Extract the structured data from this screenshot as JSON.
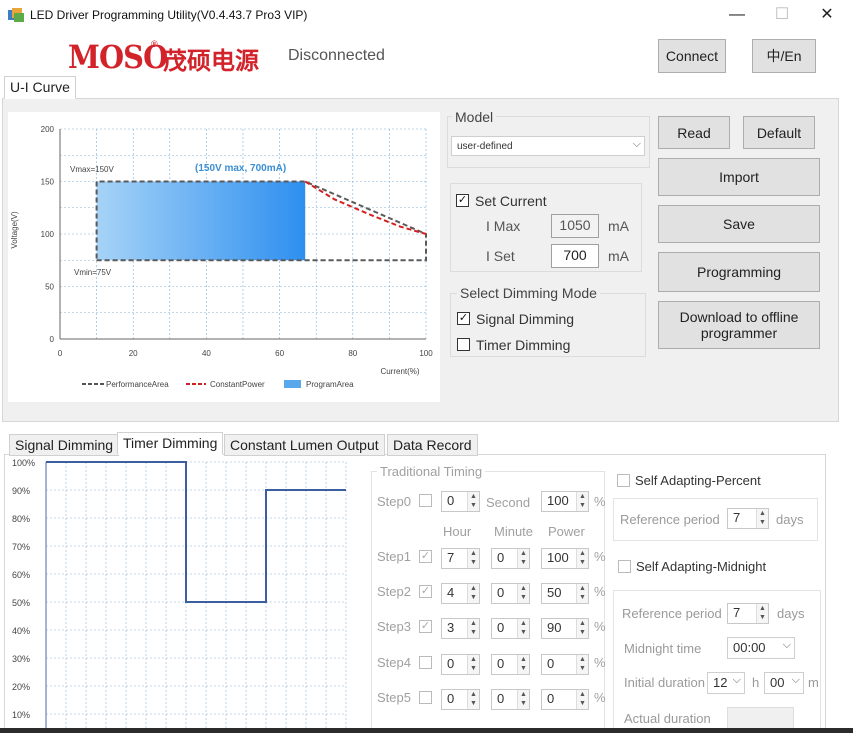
{
  "window": {
    "title": "LED Driver Programming Utility(V0.4.43.7 Pro3 VIP)",
    "minimize": "—",
    "maximize": "☐",
    "close": "✕"
  },
  "header": {
    "logo_en": "MOSO",
    "logo_reg": "®",
    "logo_cn": "茂硕电源",
    "status": "Disconnected",
    "connect_label": "Connect",
    "lang_label": "中/En"
  },
  "top_tab": "U-I Curve",
  "model": {
    "title": "Model",
    "selected": "user-defined"
  },
  "set_current": {
    "checkbox_label": "Set Current",
    "checked": true,
    "imax_label": "I Max",
    "imax_value": "1050",
    "iset_label": "I Set",
    "iset_value": "700",
    "unit": "mA"
  },
  "dimming_mode": {
    "title": "Select Dimming Mode",
    "signal_label": "Signal Dimming",
    "signal_checked": true,
    "timer_label": "Timer Dimming",
    "timer_checked": false
  },
  "buttons": {
    "read": "Read",
    "default": "Default",
    "import": "Import",
    "save": "Save",
    "programming": "Programming",
    "download_line1": "Download to offline",
    "download_line2": "programmer"
  },
  "ui_chart": {
    "ylabel": "Voltage(V)",
    "xlabel": "Current(%)",
    "yticks": [
      "0",
      "50",
      "100",
      "150",
      "200"
    ],
    "xticks": [
      "0",
      "20",
      "40",
      "60",
      "80",
      "100"
    ],
    "vmax_label": "Vmax=150V",
    "vmin_label": "Vmin=75V",
    "annotation": "(150V max, 700mA)",
    "legend": [
      "PerformanceArea",
      "ConstantPower",
      "ProgramArea"
    ]
  },
  "chart_data": [
    {
      "type": "line",
      "xlabel": "Current(%)",
      "ylabel": "Voltage(V)",
      "xlim": [
        0,
        100
      ],
      "ylim": [
        0,
        200
      ],
      "grid": true,
      "legend_position": "bottom",
      "series": [
        {
          "name": "PerformanceArea",
          "points": [
            [
              10,
              75
            ],
            [
              100,
              75
            ],
            [
              100,
              100
            ],
            [
              67,
              150
            ],
            [
              10,
              150
            ],
            [
              10,
              75
            ]
          ]
        },
        {
          "name": "ConstantPower",
          "points": [
            [
              67,
              150
            ],
            [
              75,
              133
            ],
            [
              85,
              118
            ],
            [
              93,
              107
            ],
            [
              100,
              100
            ]
          ]
        },
        {
          "name": "ProgramArea",
          "points": [
            [
              10,
              75
            ],
            [
              67,
              75
            ],
            [
              67,
              150
            ],
            [
              10,
              150
            ]
          ]
        }
      ],
      "annotations": [
        "(150V max, 700mA)",
        "Vmax=150V",
        "Vmin=75V"
      ]
    },
    {
      "type": "line",
      "ylabel": "",
      "xlabel": "",
      "ylim": [
        10,
        100
      ],
      "grid": true,
      "yticks": [
        "100%",
        "90%",
        "80%",
        "70%",
        "60%",
        "50%",
        "40%",
        "30%",
        "20%",
        "10%"
      ],
      "series": [
        {
          "points": [
            [
              0,
              100
            ],
            [
              7,
              100
            ],
            [
              7,
              50
            ],
            [
              11,
              50
            ],
            [
              11,
              90
            ],
            [
              15,
              90
            ]
          ]
        }
      ]
    }
  ],
  "bottom_tabs": [
    "Signal Dimming",
    "Timer Dimming",
    "Constant Lumen Output",
    "Data Record"
  ],
  "timing": {
    "title": "Traditional Timing",
    "step0": {
      "label": "Step0",
      "value": "0",
      "unit_label": "Second",
      "power": "100"
    },
    "headers": {
      "hour": "Hour",
      "minute": "Minute",
      "power": "Power"
    },
    "percent": "%",
    "steps": [
      {
        "label": "Step1",
        "checked": true,
        "hour": "7",
        "minute": "0",
        "power": "100"
      },
      {
        "label": "Step2",
        "checked": true,
        "hour": "4",
        "minute": "0",
        "power": "50"
      },
      {
        "label": "Step3",
        "checked": true,
        "hour": "3",
        "minute": "0",
        "power": "90"
      },
      {
        "label": "Step4",
        "checked": false,
        "hour": "0",
        "minute": "0",
        "power": "0"
      },
      {
        "label": "Step5",
        "checked": false,
        "hour": "0",
        "minute": "0",
        "power": "0"
      }
    ]
  },
  "adapting_percent": {
    "label": "Self Adapting-Percent",
    "ref_label": "Reference period",
    "ref_value": "7",
    "unit": "days"
  },
  "adapting_midnight": {
    "label": "Self Adapting-Midnight",
    "ref_label": "Reference period",
    "ref_value": "7",
    "unit": "days",
    "midnight_label": "Midnight time",
    "midnight_value": "00:00",
    "initial_label": "Initial duration",
    "initial_h": "12",
    "h": "h",
    "initial_m": "00",
    "m": "m",
    "actual_label": "Actual duration"
  }
}
